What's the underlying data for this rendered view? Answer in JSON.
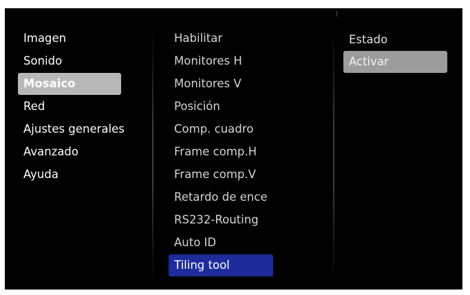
{
  "main_menu": {
    "items": [
      {
        "label": "Imagen"
      },
      {
        "label": "Sonido"
      },
      {
        "label": "Mosaico"
      },
      {
        "label": "Red"
      },
      {
        "label": "Ajustes generales"
      },
      {
        "label": "Avanzado"
      },
      {
        "label": "Ayuda"
      }
    ],
    "selected_index": 2
  },
  "submenu": {
    "items": [
      {
        "label": "Habilitar"
      },
      {
        "label": "Monitores H"
      },
      {
        "label": "Monitores V"
      },
      {
        "label": "Posición"
      },
      {
        "label": "Comp. cuadro"
      },
      {
        "label": "Frame comp.H"
      },
      {
        "label": "Frame comp.V"
      },
      {
        "label": "Retardo de ence"
      },
      {
        "label": "RS232-Routing"
      },
      {
        "label": "Auto ID"
      },
      {
        "label": "Tiling tool"
      }
    ],
    "focused_index": 10
  },
  "options": {
    "items": [
      {
        "label": "Estado"
      },
      {
        "label": "Activar"
      }
    ],
    "selected_index": 1
  },
  "colors": {
    "background": "#000000",
    "main_selected_bg": "#b8b8b8",
    "submenu_focus_bg": "#1d2b9b",
    "option_selected_bg": "#9c9c9c"
  }
}
